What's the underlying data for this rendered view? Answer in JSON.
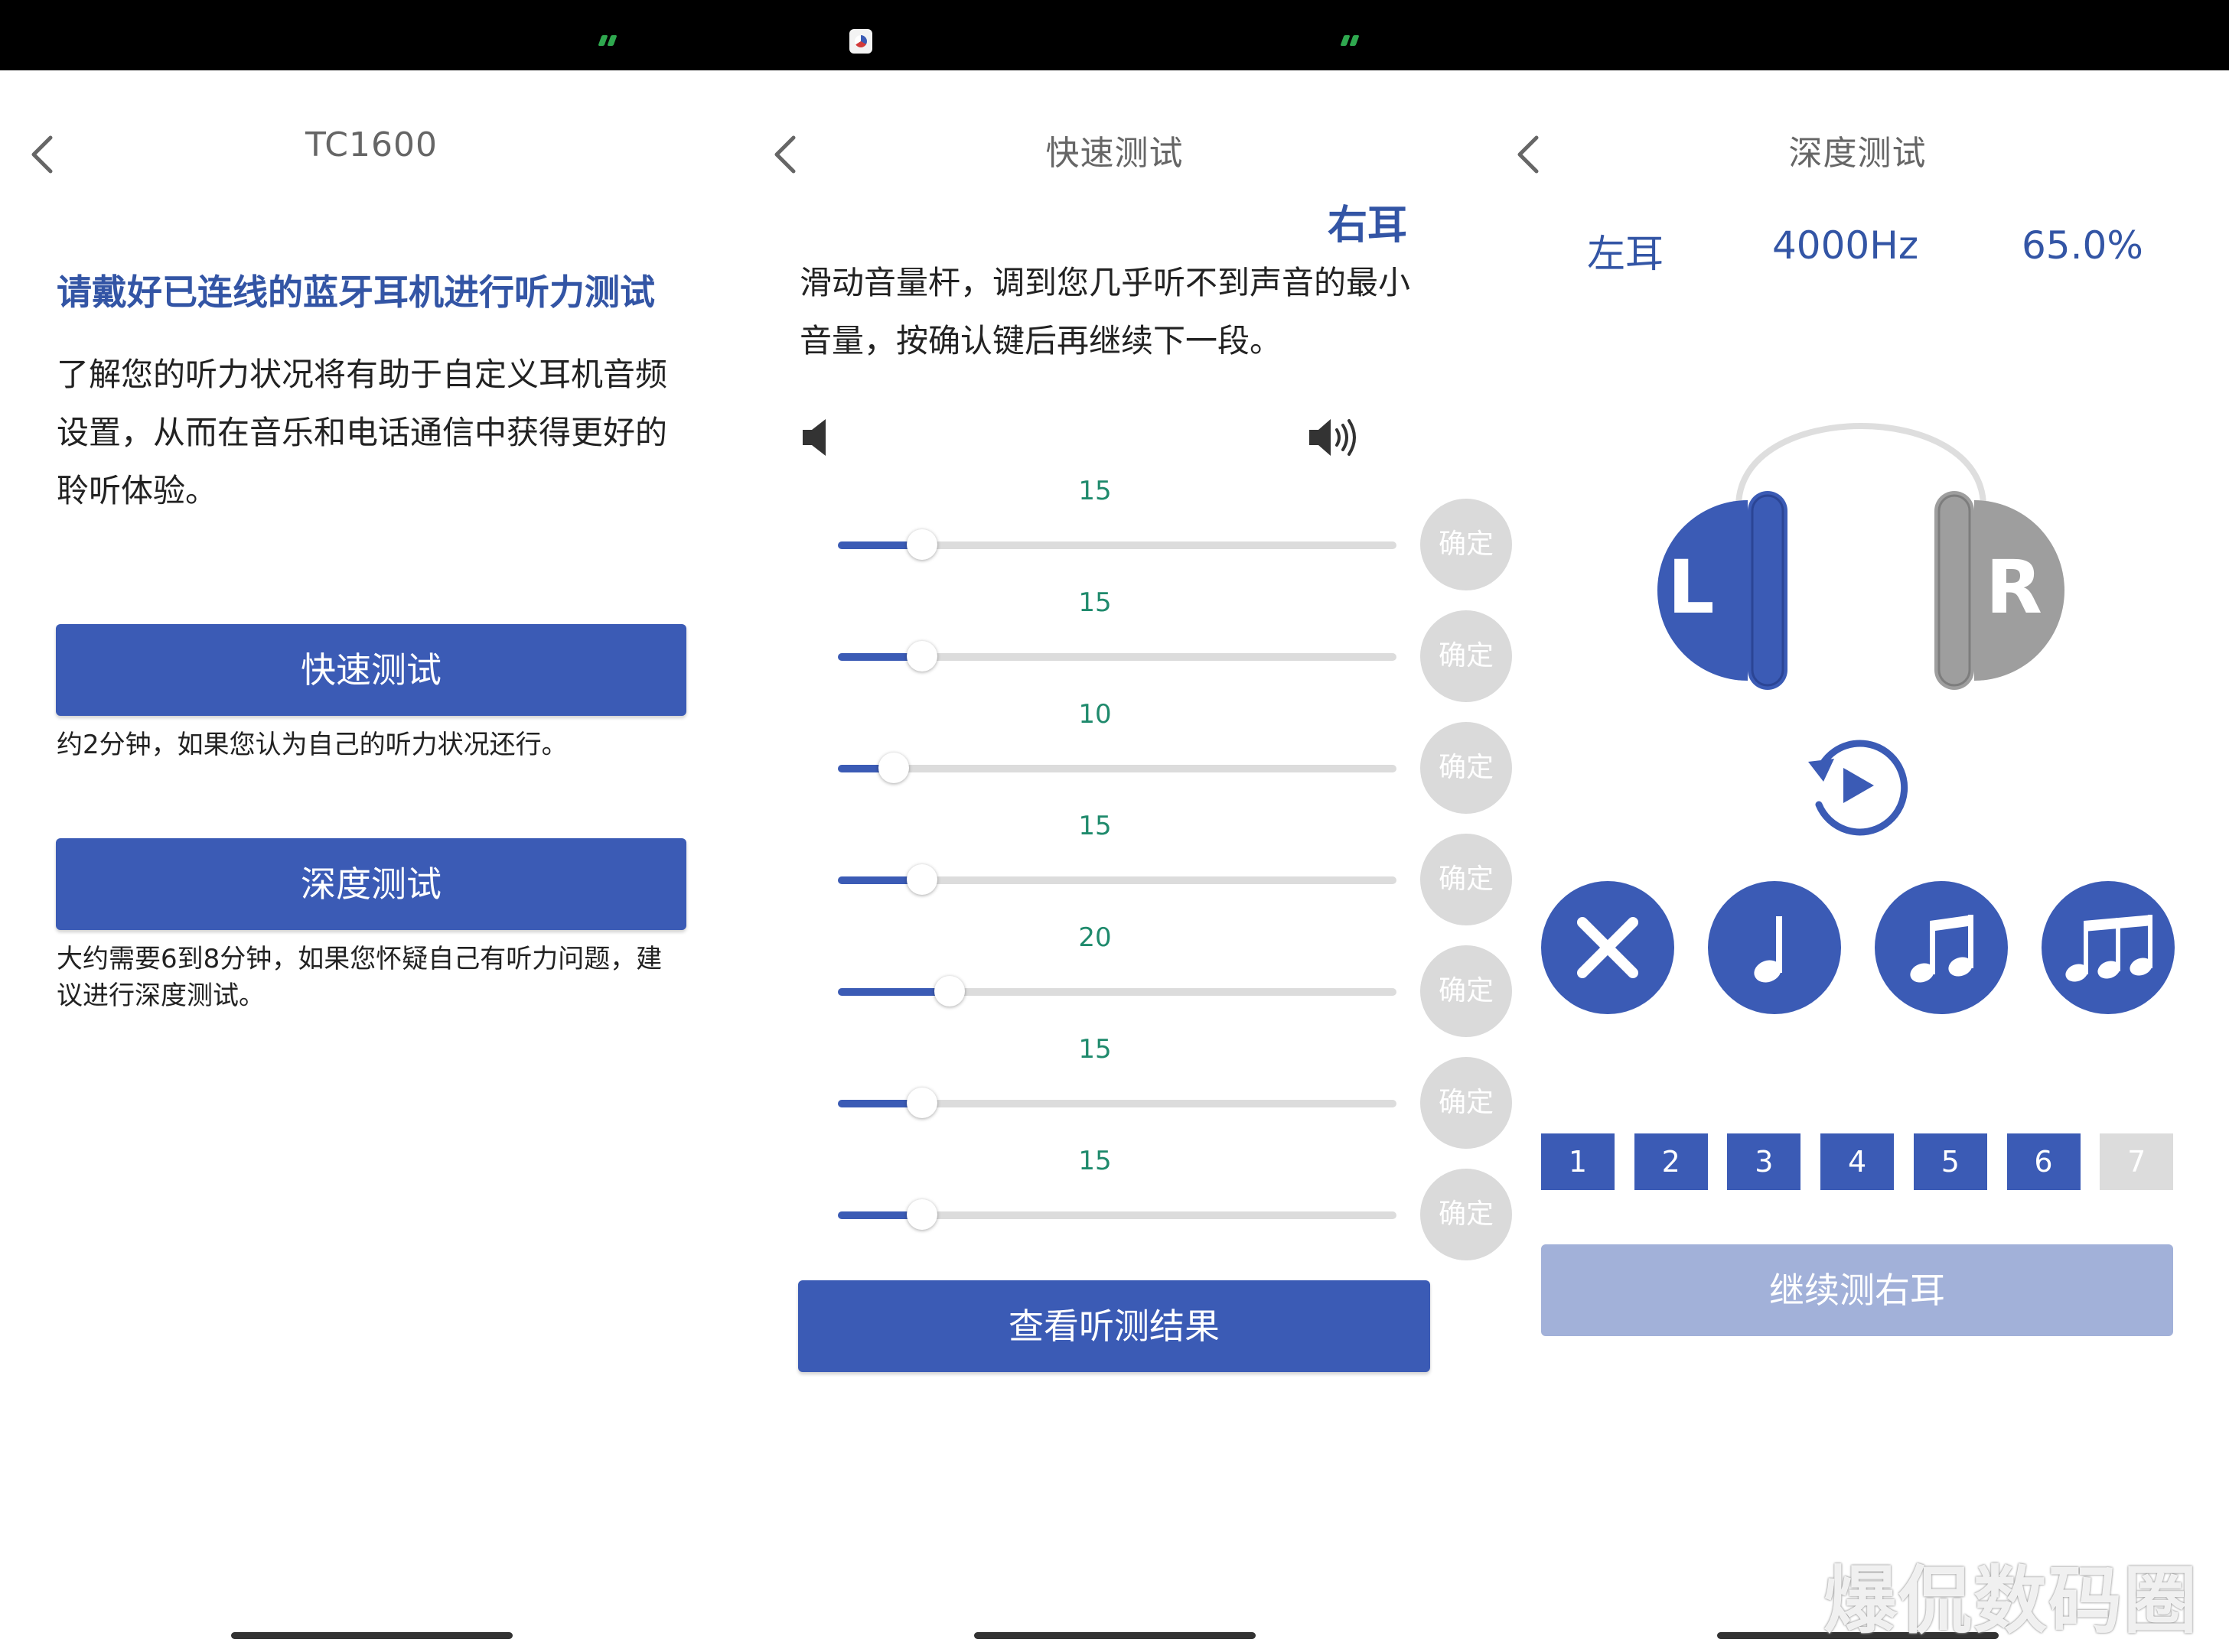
{
  "colors": {
    "accent": "#3b5bb5",
    "accent_light": "#a2b1d9",
    "value_text": "#1f8a6c",
    "disabled": "#dcdcdc"
  },
  "panel1": {
    "title": "TC1600",
    "heading": "请戴好已连线的蓝牙耳机进行听力测试",
    "body": "了解您的听力状况将有助于自定义耳机音频设置，从而在音乐和电话通信中获得更好的聆听体验。",
    "quick_button": "快速测试",
    "quick_note": "约2分钟，如果您认为自己的听力状况还行。",
    "deep_button": "深度测试",
    "deep_note": "大约需要6到8分钟，如果您怀疑自己有听力问题，建议进行深度测试。"
  },
  "panel2": {
    "title": "快速测试",
    "ear_label": "右耳",
    "instruction": "滑动音量杆，调到您几乎听不到声音的最小音量，按确认键后再继续下一段。",
    "slider_max": 100,
    "sliders": [
      {
        "value": "15",
        "confirm": "确定"
      },
      {
        "value": "15",
        "confirm": "确定"
      },
      {
        "value": "10",
        "confirm": "确定"
      },
      {
        "value": "15",
        "confirm": "确定"
      },
      {
        "value": "20",
        "confirm": "确定"
      },
      {
        "value": "15",
        "confirm": "确定"
      },
      {
        "value": "15",
        "confirm": "确定"
      }
    ],
    "result_button": "查看听测结果"
  },
  "panel3": {
    "title": "深度测试",
    "ear": "左耳",
    "frequency": "4000Hz",
    "percent": "65.0%",
    "left_letter": "L",
    "right_letter": "R",
    "steps": [
      {
        "label": "1",
        "active": true
      },
      {
        "label": "2",
        "active": true
      },
      {
        "label": "3",
        "active": true
      },
      {
        "label": "4",
        "active": true
      },
      {
        "label": "5",
        "active": true
      },
      {
        "label": "6",
        "active": true
      },
      {
        "label": "7",
        "active": false
      }
    ],
    "continue_button": "继续测右耳"
  },
  "watermark": "爆侃数码圈"
}
